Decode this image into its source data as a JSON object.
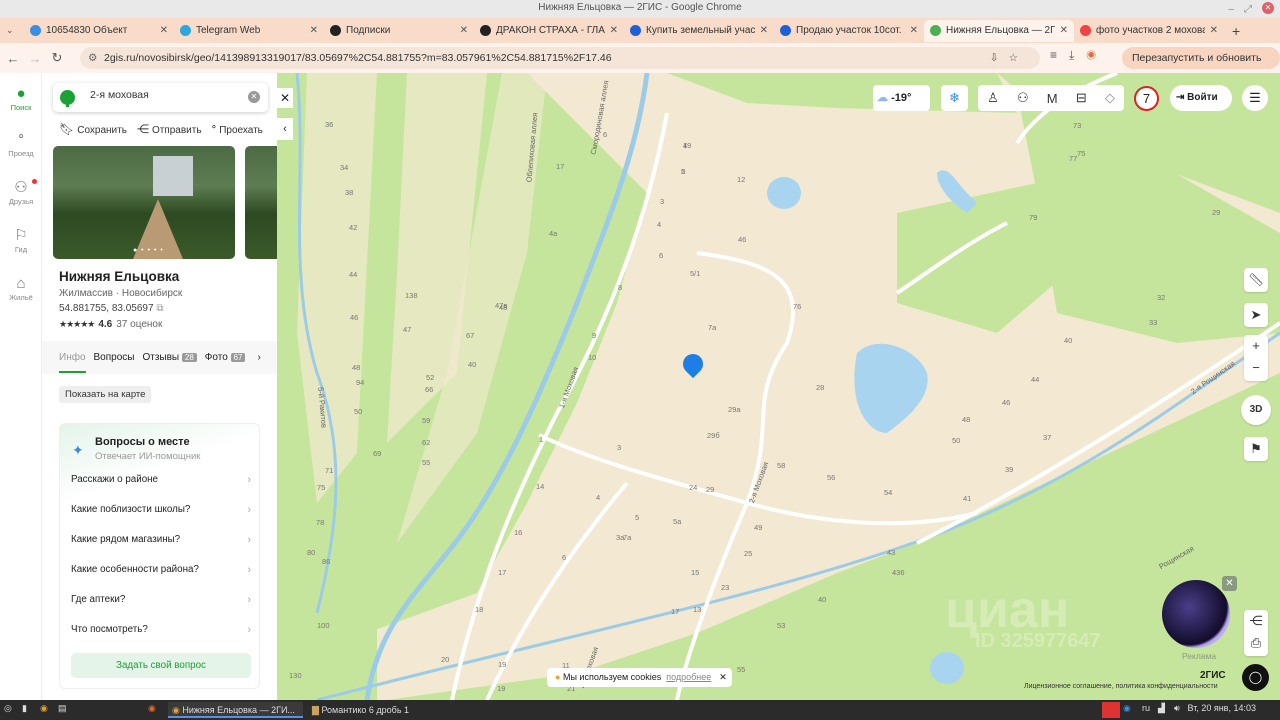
{
  "window": {
    "title": "Нижняя Ельцовка — 2ГИС - Google Chrome"
  },
  "tabs": [
    {
      "label": "10654830 Объект",
      "color": "#3a8de0"
    },
    {
      "label": "Telegram Web",
      "color": "#2ea6de"
    },
    {
      "label": "Подписки",
      "color": "#222"
    },
    {
      "label": "ДРАКОН СТРАХА - ГЛАВ",
      "color": "#222"
    },
    {
      "label": "Купить земельный участ",
      "color": "#1f5fd6"
    },
    {
      "label": "Продаю участок 10сот. 2",
      "color": "#1f5fd6"
    },
    {
      "label": "Нижняя Ельцовка — 2ГИ",
      "color": "#4caf50"
    },
    {
      "label": "фото участков 2 мохова",
      "color": "#e44"
    }
  ],
  "address": {
    "url": "2gis.ru/novosibirsk/geo/141398913319017/83.05697%2C54.881755?m=83.057961%2C54.881715%2F17.46",
    "restart_label": "Перезапустить и обновить"
  },
  "rail": [
    {
      "label": "Поиск"
    },
    {
      "label": "Проезд"
    },
    {
      "label": "Друзья"
    },
    {
      "label": "Гид"
    },
    {
      "label": "Жильё"
    }
  ],
  "search": {
    "value": "2-я моховая"
  },
  "actions": {
    "save": "Сохранить",
    "share": "Отправить",
    "route": "Проехать"
  },
  "place": {
    "name": "Нижняя Ельцовка",
    "type": "Жилмассив",
    "city": "Новосибирск",
    "coords": "54.881755, 83.05697",
    "stars": "★★★★★",
    "rating": "4.6",
    "reviews": "37 оценок"
  },
  "place_tabs": [
    {
      "label": "Инфо"
    },
    {
      "label": "Вопросы"
    },
    {
      "label": "Отзывы",
      "badge": "28"
    },
    {
      "label": "Фото",
      "badge": "67"
    }
  ],
  "show_on_map": "Показать на карте",
  "questions": {
    "title": "Вопросы о месте",
    "subtitle": "Отвечает ИИ-помощник",
    "items": [
      "Расскажи о районе",
      "Какие поблизости школы?",
      "Какие рядом магазины?",
      "Какие особенности района?",
      "Где аптеки?",
      "Что посмотреть?"
    ],
    "ask": "Задать свой вопрос"
  },
  "map": {
    "temperature": "-19°",
    "notifications": "7",
    "login": "Войти",
    "ad_label": "Реклама",
    "watermark": "циан",
    "watermark_id": "ID 325977647",
    "cookies": "Мы используем cookies",
    "cookies_more": "подробнее",
    "brand": "2ГИС",
    "legal": "Лицензионное соглашение, политика конфиденциальности",
    "zoom3d": "3D",
    "streets": [
      "2-я Моховая",
      "1-я Моховая",
      "2-я Моховая",
      "Смородиновая аллея",
      "Облепиховая аллея",
      "2-я Рощинская",
      "Рощинская",
      "Рощинская",
      "5-й Ракитов"
    ],
    "houses": [
      "1",
      "2",
      "3",
      "4",
      "6",
      "7а",
      "8",
      "9",
      "10",
      "5/1",
      "46",
      "76",
      "28",
      "29а",
      "29б",
      "58",
      "56",
      "54",
      "50",
      "48",
      "46",
      "44",
      "40",
      "37",
      "39",
      "41",
      "43",
      "436",
      "49",
      "25",
      "23",
      "15",
      "13",
      "17",
      "5а",
      "7а",
      "5",
      "4",
      "3",
      "1",
      "14",
      "16",
      "6",
      "17",
      "18",
      "20",
      "19",
      "11",
      "55",
      "53",
      "40",
      "21",
      "19",
      "29",
      "73",
      "77",
      "75",
      "79",
      "32",
      "33",
      "29",
      "24",
      "3а",
      "12",
      "6",
      "4а",
      "17",
      "36",
      "34",
      "38",
      "42",
      "44",
      "46",
      "48",
      "50",
      "52",
      "55",
      "59",
      "62",
      "66",
      "69",
      "71",
      "75",
      "78",
      "80",
      "86",
      "94",
      "100",
      "130",
      "138",
      "47",
      "47в",
      "67",
      "40",
      "48",
      "49",
      "5"
    ]
  },
  "taskbar": {
    "active_window": "Нижняя Ельцовка — 2ГИ...",
    "other_window": "Романтико 6 дробь 1",
    "lang": "ru",
    "clock": "Вт, 20 янв, 14:03"
  }
}
